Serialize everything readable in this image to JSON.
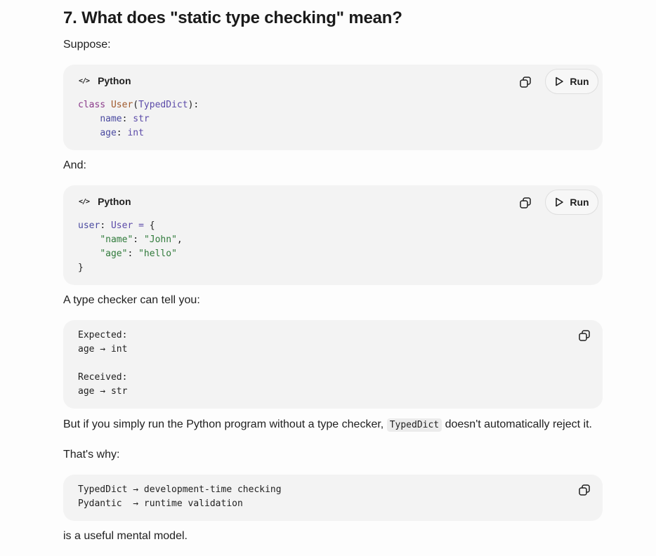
{
  "heading": "7. What does \"static type checking\" mean?",
  "paragraphs": {
    "suppose": "Suppose:",
    "and": "And:",
    "checker": "A type checker can tell you:",
    "but_prefix": "But if you simply run the Python program without a type checker,",
    "but_code": "TypedDict",
    "but_suffix": "doesn't automatically reject it.",
    "thats_why": "That's why:",
    "mental_model": "is a useful mental model."
  },
  "code_blocks": [
    {
      "language": "Python",
      "run_label": "Run",
      "lines": [
        {
          "t1": "class",
          "t2": "User",
          "t3": "(",
          "t4": "TypedDict",
          "t5": "):"
        },
        {
          "indent": "    ",
          "name": "name",
          "sep": ": ",
          "type": "str"
        },
        {
          "indent": "    ",
          "name": "age",
          "sep": ": ",
          "type": "int"
        }
      ]
    },
    {
      "language": "Python",
      "run_label": "Run",
      "lines": [
        {
          "v": "user",
          "c": ": ",
          "ty": "User",
          "eq": " = ",
          "b": "{"
        },
        {
          "indent": "    ",
          "k": "\"name\"",
          "c": ": ",
          "v": "\"John\"",
          "e": ","
        },
        {
          "indent": "    ",
          "k": "\"age\"",
          "c": ": ",
          "v": "\"hello\"",
          "e": ""
        },
        {
          "b": "}"
        }
      ]
    },
    {
      "text": "Expected:\nage → int\n\nReceived:\nage → str"
    },
    {
      "text": "TypedDict → development-time checking\nPydantic  → runtime validation"
    }
  ],
  "icons": {
    "code": "code-icon",
    "copy": "copy-icon",
    "play": "play-icon"
  }
}
